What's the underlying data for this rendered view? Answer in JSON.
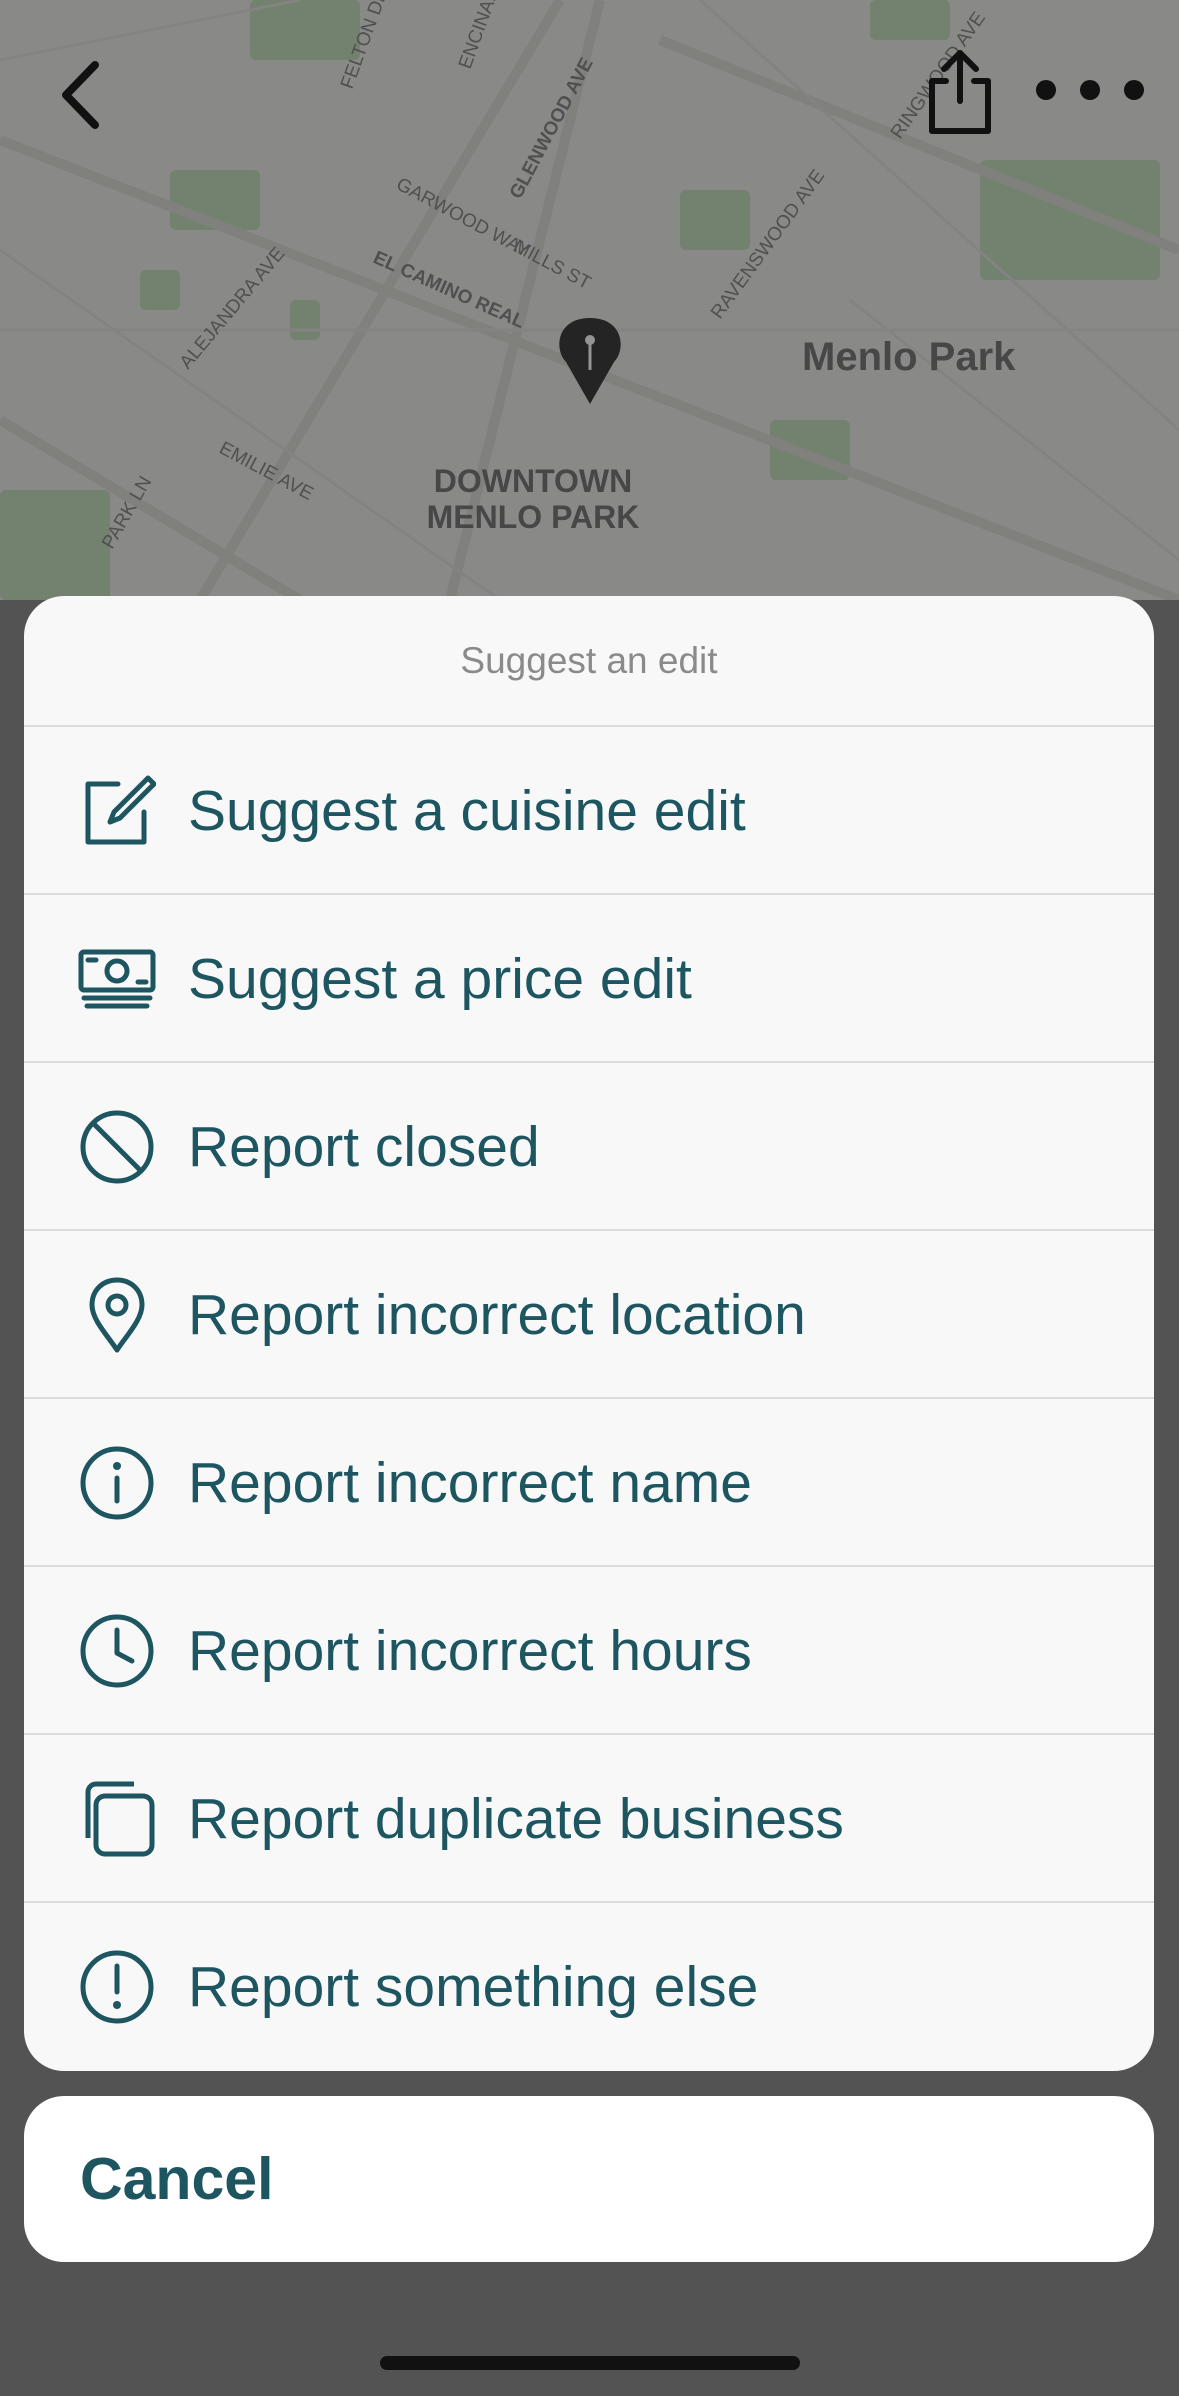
{
  "map": {
    "area_name": "Menlo Park",
    "district_label_1": "DOWNTOWN",
    "district_label_2": "MENLO PARK",
    "streets": [
      "EL CAMINO REAL",
      "GLENWOOD AVE",
      "GARWOOD WAY",
      "MILLS ST",
      "RAVENSWOOD AVE",
      "ALEJANDRA AVE",
      "EMILIE AVE",
      "PARK LN",
      "FELTON DR",
      "ENCINAL",
      "RINGWOOD AVE"
    ]
  },
  "top_bar": {
    "back_icon": "chevron-left-icon",
    "share_icon": "share-icon",
    "more_icon": "ellipsis-icon"
  },
  "sheet": {
    "title": "Suggest an edit",
    "items": [
      {
        "label": "Suggest a cuisine edit",
        "icon": "edit-icon"
      },
      {
        "label": "Suggest a price edit",
        "icon": "cash-icon"
      },
      {
        "label": "Report closed",
        "icon": "prohibited-icon"
      },
      {
        "label": "Report incorrect location",
        "icon": "location-pin-icon"
      },
      {
        "label": "Report incorrect name",
        "icon": "info-icon"
      },
      {
        "label": "Report incorrect hours",
        "icon": "clock-icon"
      },
      {
        "label": "Report duplicate business",
        "icon": "duplicate-icon"
      },
      {
        "label": "Report something else",
        "icon": "alert-icon"
      }
    ]
  },
  "cancel_label": "Cancel",
  "colors": {
    "accent": "#1d5560",
    "sheet_bg": "#f8f8f8",
    "separator": "#dcdcdc",
    "title_gray": "#8a8a8a"
  }
}
